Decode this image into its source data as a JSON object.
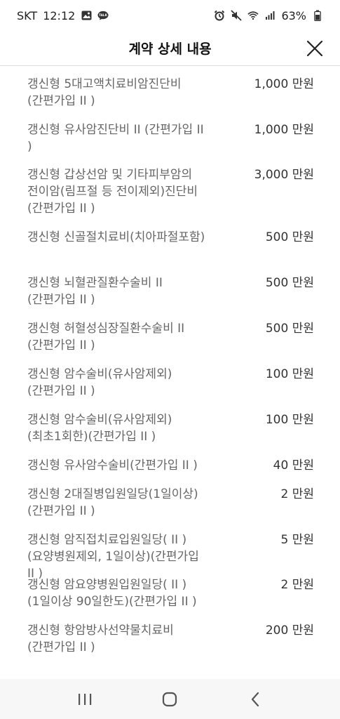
{
  "status_bar": {
    "carrier": "SKT",
    "time": "12:12",
    "battery": "63%",
    "left_icons": [
      "image-icon",
      "talk-icon"
    ],
    "right_icons": [
      "alarm-icon",
      "mute-icon",
      "wifi-icon",
      "signal-icon",
      "battery-icon"
    ]
  },
  "header": {
    "title": "계약 상세 내용",
    "close_icon": "close-icon"
  },
  "items": [
    {
      "name": "갱신형 5대고액치료비암진단비(간편가입 II )",
      "value": "1,000 만원"
    },
    {
      "name": "갱신형 유사암진단비 II (간편가입 II )",
      "value": "1,000 만원"
    },
    {
      "name": "갱신형 갑상선암 및 기타피부암의 전이암(림프절 등 전이제외)진단비 (간편가입 II )",
      "value": "3,000 만원"
    },
    {
      "name": "갱신형 신골절치료비(치아파절포함)",
      "value": "500 만원"
    },
    {
      "name": "갱신형 뇌혈관질환수술비 II (간편가입 II )",
      "value": "500 만원"
    },
    {
      "name": "갱신형 허혈성심장질환수술비 II (간편가입 II )",
      "value": "500 만원"
    },
    {
      "name": "갱신형 암수술비(유사암제외)(간편가입 II )",
      "value": "100 만원"
    },
    {
      "name": "갱신형 암수술비(유사암제외)(최초1회한)(간편가입 II )",
      "value": "100 만원"
    },
    {
      "name": "갱신형 유사암수술비(간편가입 II )",
      "value": "40 만원"
    },
    {
      "name": "갱신형 2대질병입원일당(1일이상) (간편가입 II )",
      "value": "2 만원"
    },
    {
      "name": "갱신형 암직접치료입원일당( II )(요양병원제외, 1일이상)(간편가입 II )",
      "value": "5 만원"
    },
    {
      "name": "갱신형 암요양병원입원일당( II )(1일이상 90일한도)(간편가입 II )",
      "value": "2 만원"
    },
    {
      "name": "갱신형 항암방사선약물치료비(간편가입 II )",
      "value": "200 만원"
    }
  ],
  "nav_bar": {
    "icons": [
      "recent-apps-icon",
      "home-icon",
      "back-icon"
    ]
  }
}
